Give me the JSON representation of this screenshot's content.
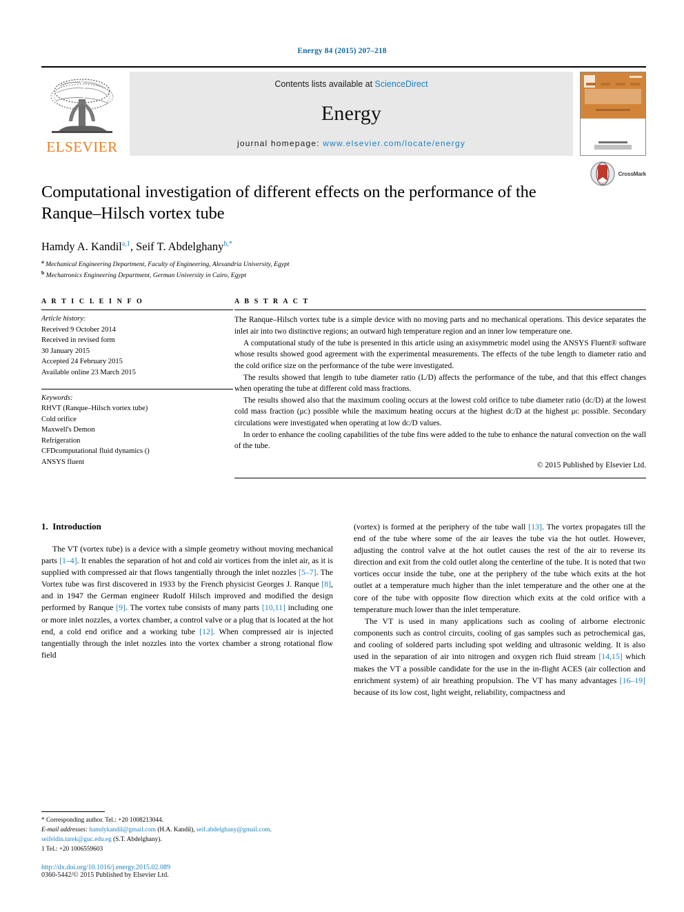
{
  "running_head": "Energy 84 (2015) 207–218",
  "masthead": {
    "publisher_name": "ELSEVIER",
    "contents_prefix": "Contents lists available at ",
    "contents_link": "ScienceDirect",
    "journal_title": "Energy",
    "homepage_prefix": "journal homepage: ",
    "homepage_url": "www.elsevier.com/locate/energy",
    "cover_word": "ENERGY",
    "link_color": "#1a7fc1",
    "panel_bg": "#e8e8e8",
    "elsevier_orange": "#f07d1a"
  },
  "article": {
    "title": "Computational investigation of different effects on the performance of the Ranque–Hilsch vortex tube",
    "authors": "Hamdy A. Kandil a,1, Seif T. Abdelghany b,*",
    "author_parts": [
      {
        "name": "Hamdy A. Kandil",
        "marks": "a,1"
      },
      {
        "name": "Seif T. Abdelghany",
        "marks": "b,*"
      }
    ],
    "affiliations": [
      {
        "mark": "a",
        "text": "Mechanical Engineering Department, Faculty of Engineering, Alexandria University, Egypt"
      },
      {
        "mark": "b",
        "text": "Mechatronics Engineering Department, German University in Cairo, Egypt"
      }
    ],
    "crossmark_label": "CrossMark"
  },
  "info": {
    "heading": "A R T I C L E   I N F O",
    "history_label": "Article history:",
    "history": [
      "Received 9 October 2014",
      "Received in revised form",
      "30 January 2015",
      "Accepted 24 February 2015",
      "Available online 23 March 2015"
    ],
    "keywords_label": "Keywords:",
    "keywords": [
      "RHVT (Ranque–Hilsch vortex tube)",
      "Cold orifice",
      "Maxwell's Demon",
      "Refrigeration",
      "CFDcomputational fluid dynamics ()",
      "ANSYS fluent"
    ]
  },
  "abstract": {
    "heading": "A B S T R A C T",
    "paragraphs": [
      "The Ranque–Hilsch vortex tube is a simple device with no moving parts and no mechanical operations. This device separates the inlet air into two distinctive regions; an outward high temperature region and an inner low temperature one.",
      "A computational study of the tube is presented in this article using an axisymmetric model using the ANSYS Fluent® software whose results showed good agreement with the experimental measurements. The effects of the tube length to diameter ratio and the cold orifice size on the performance of the tube were investigated.",
      "The results showed that length to tube diameter ratio (L/D) affects the performance of the tube, and that this effect changes when operating the tube at different cold mass fractions.",
      "The results showed also that the maximum cooling occurs at the lowest cold orifice to tube diameter ratio (dᴄ/D) at the lowest cold mass fraction (μᴄ) possible while the maximum heating occurs at the highest dᴄ/D at the highest μᴄ possible. Secondary circulations were investigated when operating at low dᴄ/D values.",
      "In order to enhance the cooling capabilities of the tube fins were added to the tube to enhance the natural convection on the wall of the tube."
    ],
    "copyright": "© 2015 Published by Elsevier Ltd."
  },
  "body": {
    "section_number": "1.",
    "section_title": "Introduction",
    "left_paragraph": "The VT (vortex tube) is a device with a simple geometry without moving mechanical parts [1–4]. It enables the separation of hot and cold air vortices from the inlet air, as it is supplied with compressed air that flows tangentially through the inlet nozzles [5–7]. The Vortex tube was first discovered in 1933 by the French physicist Georges J. Ranque [8], and in 1947 the German engineer Rudolf Hilsch improved and modified the design performed by Ranque [9]. The vortex tube consists of many parts [10,11] including one or more inlet nozzles, a vortex chamber, a control valve or a plug that is located at the hot end, a cold end orifice and a working tube [12]. When compressed air is injected tangentially through the inlet nozzles into the vortex chamber a strong rotational flow field",
    "right_paragraph_1": "(vortex) is formed at the periphery of the tube wall [13]. The vortex propagates till the end of the tube where some of the air leaves the tube via the hot outlet. However, adjusting the control valve at the hot outlet causes the rest of the air to reverse its direction and exit from the cold outlet along the centerline of the tube. It is noted that two vortices occur inside the tube, one at the periphery of the tube which exits at the hot outlet at a temperature much higher than the inlet temperature and the other one at the core of the tube with opposite flow direction which exits at the cold orifice with a temperature much lower than the inlet temperature.",
    "right_paragraph_2": "The VT is used in many applications such as cooling of airborne electronic components such as control circuits, cooling of gas samples such as petrochemical gas, and cooling of soldered parts including spot welding and ultrasonic welding. It is also used in the separation of air into nitrogen and oxygen rich fluid stream [14,15] which makes the VT a possible candidate for the use in the in-flight ACES (air collection and enrichment system) of air breathing propulsion. The VT has many advantages [16–19] because of its low cost, light weight, reliability, compactness and"
  },
  "footnotes": {
    "corresponding": "* Corresponding author. Tel.: +20 1008213044.",
    "email_label": "E-mail addresses:",
    "email_1": "hamdykandil@gmail.com",
    "email_1_owner": "(H.A. Kandil),",
    "email_2": "seif.abdelghany@gmail.com, seifeldin.tarek@guc.edu.eg",
    "email_2_owner": "(S.T. Abdelghany).",
    "tel_note": "1 Tel.: +20 1006559603",
    "doi": "http://dx.doi.org/10.1016/j.energy.2015.02.089",
    "issn_line": "0360-5442/© 2015 Published by Elsevier Ltd."
  }
}
